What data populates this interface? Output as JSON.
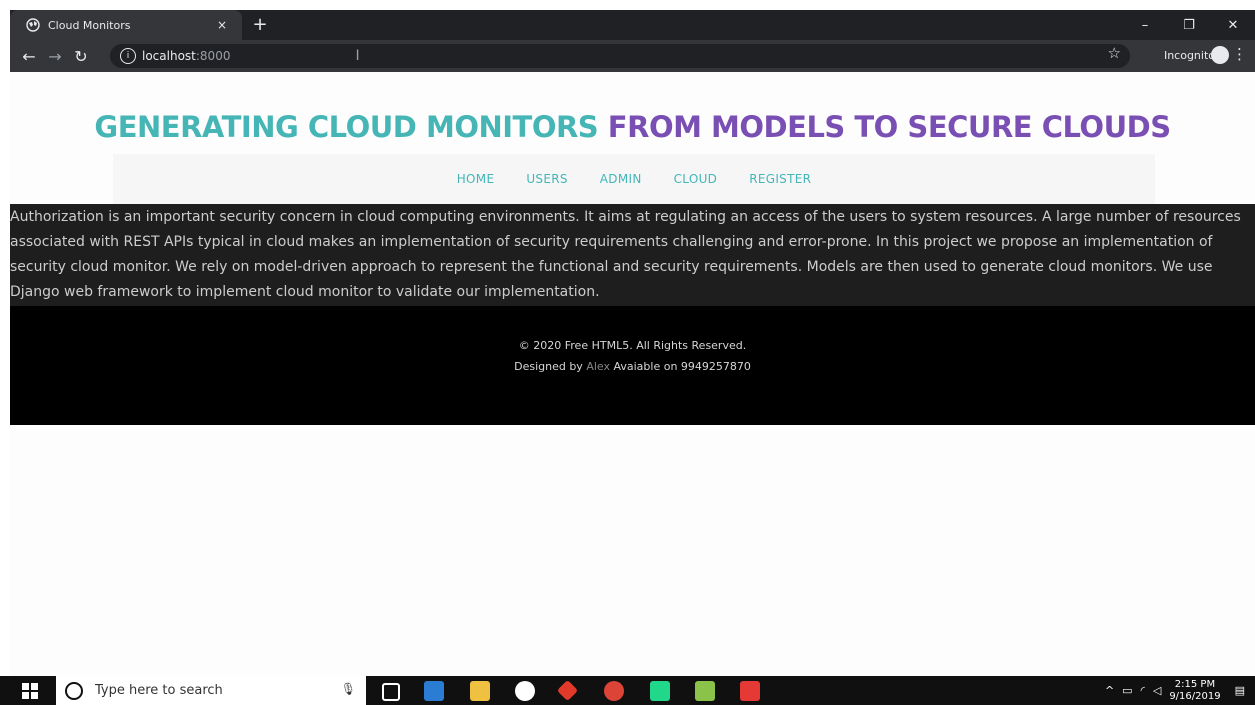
{
  "browser": {
    "tab_title": "Cloud Monitors",
    "tab_close": "×",
    "new_tab": "+",
    "url_host": "localhost",
    "url_port": ":8000",
    "incognito_label": "Incognito",
    "window_controls": {
      "minimize": "–",
      "restore": "❐",
      "close": "✕"
    }
  },
  "page": {
    "heading_part1": "GENERATING CLOUD MONITORS",
    "heading_part2": "FROM MODELS TO SECURE CLOUDS",
    "nav": [
      "HOME",
      "USERS",
      "ADMIN",
      "CLOUD",
      "REGISTER"
    ],
    "intro_text": "Authorization is an important security concern in cloud computing environments. It aims at regulating an access of the users to system resources. A large number of resources associated with REST APIs typical in cloud makes an implementation of security requirements challenging and error-prone. In this project we propose an implementation of security cloud monitor. We rely on model-driven approach to represent the functional and security requirements. Models are then used to generate cloud monitors. We use Django web framework to implement cloud monitor to validate our implementation.",
    "footer_line1": "© 2020 Free HTML5. All Rights Reserved.",
    "footer_designed_prefix": "Designed by",
    "footer_designer": "Alex",
    "footer_suffix": "Avaiable on 9949257870"
  },
  "taskbar": {
    "search_placeholder": "Type here to search",
    "time": "2:15 PM",
    "date": "9/16/2019"
  },
  "colors": {
    "heading_teal": "#45b5b5",
    "heading_purple": "#7a4fb4",
    "nav_link": "#44b6b8"
  }
}
